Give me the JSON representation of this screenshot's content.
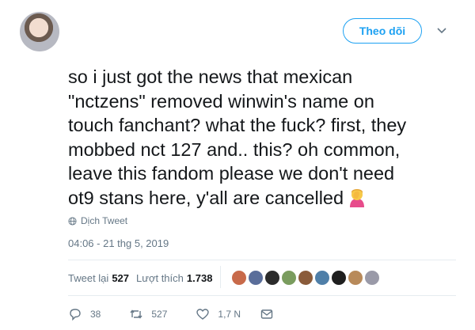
{
  "header": {
    "follow_label": "Theo dõi"
  },
  "tweet": {
    "lines": [
      "so i just got the news that mexican",
      "\"nctzens\" removed winwin's name on",
      "touch fanchant? what the fuck? first, they",
      "mobbed nct 127 and.. this? oh common,",
      "leave this fandom please we don't need",
      "ot9 stans here, y'all are cancelled"
    ],
    "translate_label": "Dịch Tweet",
    "timestamp": "04:06 - 21 thg 5, 2019"
  },
  "stats": {
    "retweets_label": "Tweet lại",
    "retweets_count": "527",
    "likes_label": "Lượt thích",
    "likes_count": "1.738"
  },
  "likers": {
    "colors": [
      "#c86a4a",
      "#5a6e9a",
      "#2b2b2b",
      "#7a9c5e",
      "#8a5b3a",
      "#4f7fa8",
      "#1f1f1f",
      "#b88a5a",
      "#9a9aa8"
    ]
  },
  "actions": {
    "reply_count": "38",
    "retweet_count": "527",
    "like_count": "1,7 N"
  },
  "colors": {
    "accent": "#1da1f2",
    "muted": "#657786",
    "text": "#14171a"
  }
}
